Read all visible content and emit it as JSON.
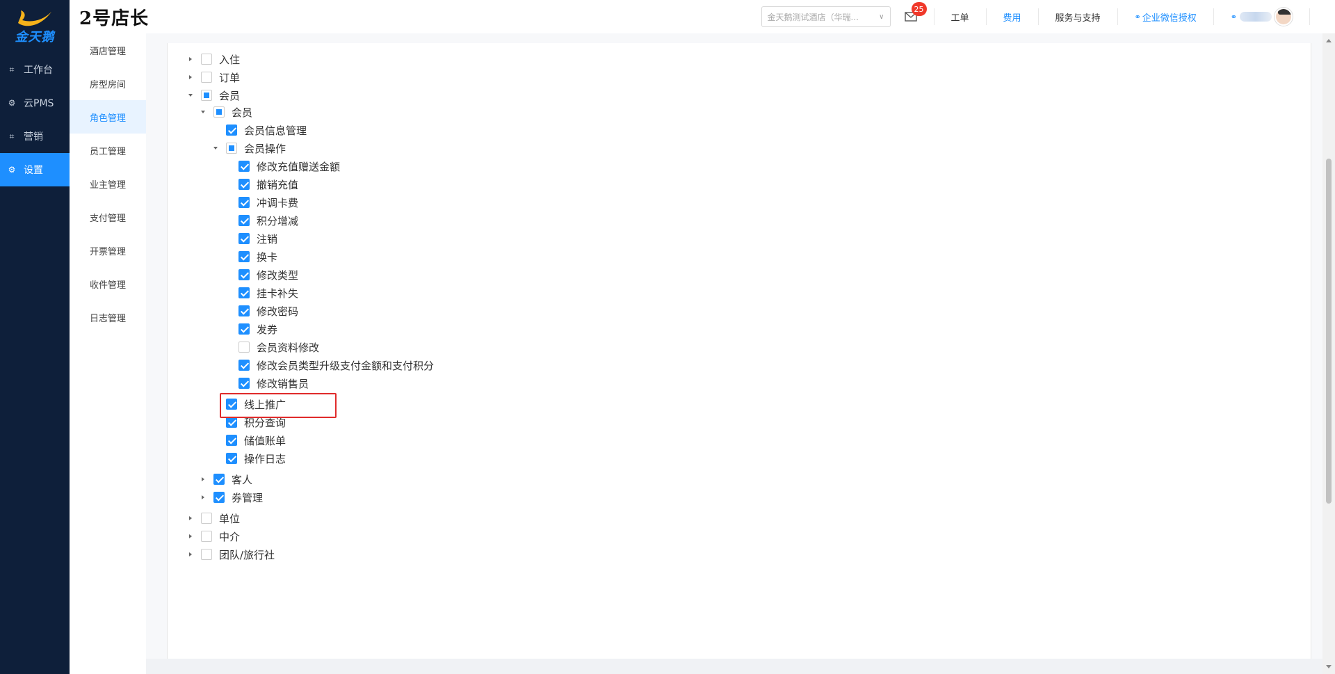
{
  "brand": {
    "logo_text": "金天鹅",
    "logo_color": "#1e8fff"
  },
  "sidebar": {
    "items": [
      {
        "label": "工作台",
        "icon": "scan-icon",
        "active": false
      },
      {
        "label": "云PMS",
        "icon": "gear-icon",
        "active": false
      },
      {
        "label": "营销",
        "icon": "scan-icon",
        "active": false
      },
      {
        "label": "设置",
        "icon": "gear-icon",
        "active": true
      }
    ]
  },
  "header": {
    "title": "2号店长",
    "hotel_select": "金天鹅测试酒店（华瑞...",
    "mail_badge": "25",
    "links": [
      "工单",
      "费用",
      "服务与支持",
      "企业微信授权"
    ]
  },
  "submenu": {
    "items": [
      "酒店管理",
      "房型房间",
      "角色管理",
      "员工管理",
      "业主管理",
      "支付管理",
      "开票管理",
      "收件管理",
      "日志管理"
    ],
    "active_index": 2
  },
  "tree": [
    {
      "label": "入住",
      "state": "unchecked",
      "caret": "right"
    },
    {
      "label": "订单",
      "state": "unchecked",
      "caret": "right"
    },
    {
      "label": "会员",
      "state": "partial",
      "caret": "down"
    },
    {
      "label": "会员",
      "state": "partial",
      "caret": "down"
    },
    {
      "label": "会员信息管理",
      "state": "checked",
      "caret": "none"
    },
    {
      "label": "会员操作",
      "state": "partial",
      "caret": "down"
    },
    {
      "label": "修改充值赠送金额",
      "state": "checked",
      "caret": "none"
    },
    {
      "label": "撤销充值",
      "state": "checked",
      "caret": "none"
    },
    {
      "label": "冲调卡费",
      "state": "checked",
      "caret": "none"
    },
    {
      "label": "积分增减",
      "state": "checked",
      "caret": "none"
    },
    {
      "label": "注销",
      "state": "checked",
      "caret": "none"
    },
    {
      "label": "换卡",
      "state": "checked",
      "caret": "none"
    },
    {
      "label": "修改类型",
      "state": "checked",
      "caret": "none"
    },
    {
      "label": "挂卡补失",
      "state": "checked",
      "caret": "none"
    },
    {
      "label": "修改密码",
      "state": "checked",
      "caret": "none"
    },
    {
      "label": "发券",
      "state": "checked",
      "caret": "none"
    },
    {
      "label": "会员资料修改",
      "state": "unchecked",
      "caret": "none"
    },
    {
      "label": "修改会员类型升级支付金额和支付积分",
      "state": "checked",
      "caret": "none"
    },
    {
      "label": "修改销售员",
      "state": "checked",
      "caret": "none"
    },
    {
      "label": "线上推广",
      "state": "checked",
      "caret": "none"
    },
    {
      "label": "积分查询",
      "state": "checked",
      "caret": "none"
    },
    {
      "label": "储值账单",
      "state": "checked",
      "caret": "none"
    },
    {
      "label": "操作日志",
      "state": "checked",
      "caret": "none"
    },
    {
      "label": "客人",
      "state": "checked",
      "caret": "right"
    },
    {
      "label": "券管理",
      "state": "checked",
      "caret": "right"
    },
    {
      "label": "单位",
      "state": "unchecked",
      "caret": "right"
    },
    {
      "label": "中介",
      "state": "unchecked",
      "caret": "right"
    },
    {
      "label": "团队/旅行社",
      "state": "unchecked",
      "caret": "right"
    }
  ]
}
